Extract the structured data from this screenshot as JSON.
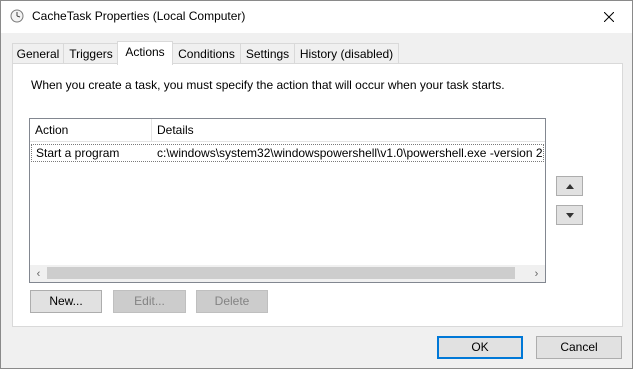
{
  "window": {
    "title": "CacheTask Properties (Local Computer)"
  },
  "tabs": [
    {
      "label": "General"
    },
    {
      "label": "Triggers"
    },
    {
      "label": "Actions"
    },
    {
      "label": "Conditions"
    },
    {
      "label": "Settings"
    },
    {
      "label": "History (disabled)"
    }
  ],
  "active_tab": "Actions",
  "actions_panel": {
    "description": "When you create a task, you must specify the action that will occur when your task starts.",
    "columns": [
      "Action",
      "Details"
    ],
    "rows": [
      {
        "action": "Start a program",
        "details": "c:\\windows\\system32\\windowspowershell\\v1.0\\powershell.exe -version 2"
      }
    ],
    "buttons": {
      "new": "New...",
      "edit": "Edit...",
      "delete": "Delete"
    }
  },
  "dialog_buttons": {
    "ok": "OK",
    "cancel": "Cancel"
  },
  "colors": {
    "accent": "#0078d7",
    "background": "#f0f0f0",
    "panel": "#ffffff"
  }
}
